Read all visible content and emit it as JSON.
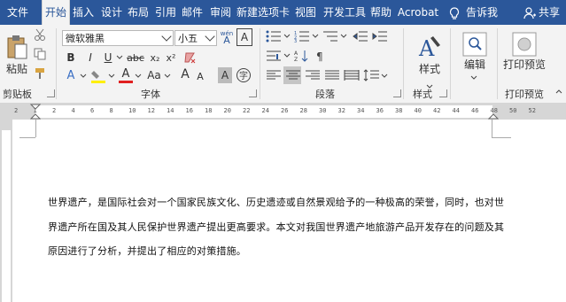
{
  "tabs": [
    "文件",
    "开始",
    "插入",
    "设计",
    "布局",
    "引用",
    "邮件",
    "审阅",
    "新建选项卡",
    "视图",
    "开发工具",
    "帮助",
    "Acrobat"
  ],
  "active_tab": "开始",
  "tell_me": "告诉我",
  "share": "共享",
  "font": {
    "name": "微软雅黑",
    "size": "小五"
  },
  "groups": {
    "clipboard": "剪贴板",
    "font": "字体",
    "paragraph": "段落",
    "styles": "样式",
    "print": "打印预览"
  },
  "buttons": {
    "paste": "粘贴",
    "styles": "样式",
    "edit": "编辑",
    "print_preview": "打印预览",
    "bold": "B",
    "italic": "I",
    "underline": "U",
    "strike": "abc",
    "sub": "x₂",
    "sup": "x²",
    "font_color": "A",
    "aa": "Aa",
    "grow": "A",
    "shrink": "A",
    "char_border": "A",
    "char_shade": "A",
    "wen": "wén",
    "wen_a": "A"
  },
  "ruler_numbers": [
    "2",
    "1",
    "2",
    "4",
    "6",
    "8",
    "10",
    "12",
    "14",
    "16",
    "18",
    "20",
    "22",
    "24",
    "26",
    "28",
    "30",
    "32",
    "34",
    "36",
    "38",
    "40",
    "42",
    "44",
    "46",
    "48",
    "50",
    "52"
  ],
  "document": {
    "lines": [
      "世界遗产，是国际社会对一个国家民族文化、历史遗迹或自然景观给予的一种极高的荣誉，同时，也对世",
      "界遗产所在国及其人民保护世界遗产提出更高要求。本文对我国世界遗产地旅游产品开发存在的问题及其",
      "原因进行了分析，并提出了相应的对策措施。"
    ]
  },
  "colors": {
    "ribbon_blue": "#2b579a",
    "ribbon_bg": "#f3f3f3"
  }
}
